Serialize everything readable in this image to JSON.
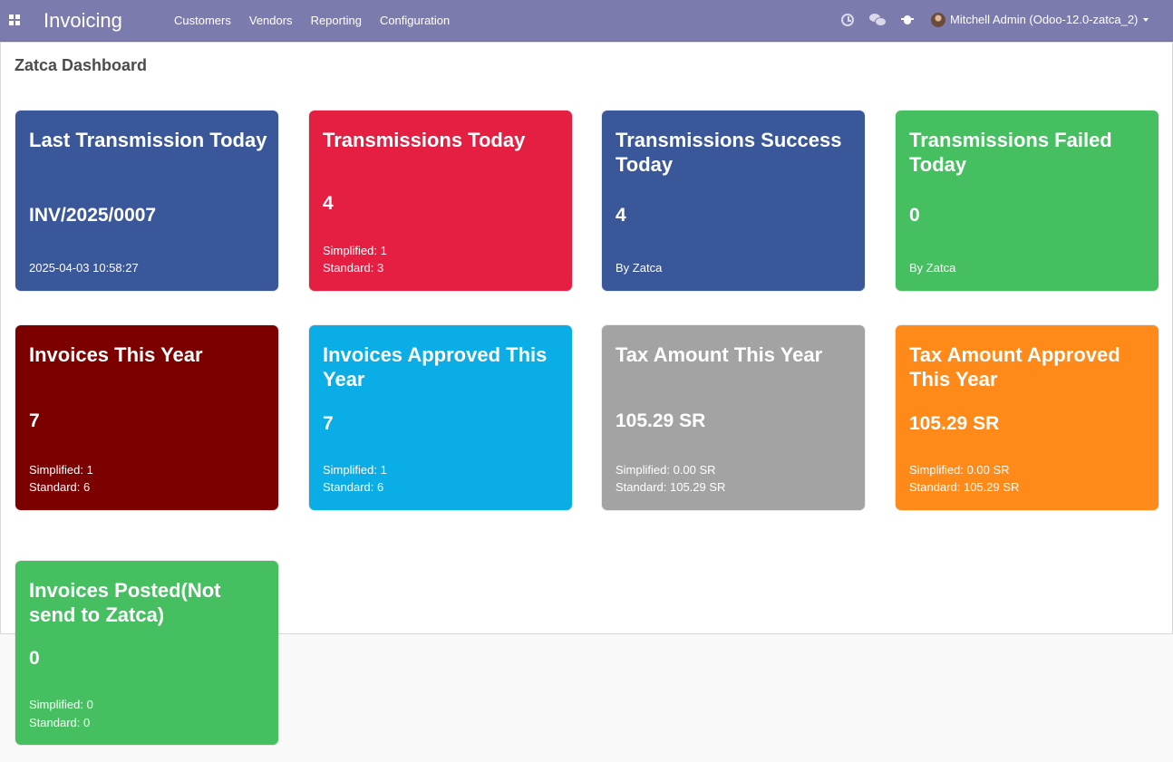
{
  "navbar": {
    "app_name": "Invoicing",
    "menu": [
      "Customers",
      "Vendors",
      "Reporting",
      "Configuration"
    ],
    "user_name": "Mitchell Admin (Odoo-12.0-zatca_2)",
    "icons": [
      "apps-icon",
      "clock-icon",
      "chat-icon",
      "bug-icon",
      "avatar",
      "chevron-down-icon"
    ],
    "background_color": "#7c7bad"
  },
  "page": {
    "title": "Zatca Dashboard"
  },
  "cards": [
    {
      "title": "Last Transmission Today",
      "value": "INV/2025/0007",
      "sub1": "2025-04-03 10:58:27",
      "sub2": "",
      "color": "#3a5799"
    },
    {
      "title": "Transmissions Today",
      "value": "4",
      "sub1": "Simplified: 1",
      "sub2": "Standard: 3",
      "color": "#e41f42"
    },
    {
      "title": "Transmissions Success Today",
      "value": "4",
      "sub1": "By Zatca",
      "sub2": "",
      "color": "#3a5799"
    },
    {
      "title": "Transmissions Failed Today",
      "value": "0",
      "sub1": "By Zatca",
      "sub2": "",
      "color": "#46bf61"
    },
    {
      "title": "Invoices This Year",
      "value": "7",
      "sub1": "Simplified: 1",
      "sub2": "Standard: 6",
      "color": "#7d0001"
    },
    {
      "title": "Invoices Approved This Year",
      "value": "7",
      "sub1": "Simplified: 1",
      "sub2": "Standard: 6",
      "color": "#0bade6"
    },
    {
      "title": "Tax Amount This Year",
      "value": "105.29 SR",
      "sub1": "Simplified: 0.00 SR",
      "sub2": "Standard: 105.29 SR",
      "color": "#a3a3a3"
    },
    {
      "title": "Tax Amount Approved This Year",
      "value": "105.29 SR",
      "sub1": "Simplified: 0.00 SR",
      "sub2": "Standard: 105.29 SR",
      "color": "#ff8a19"
    },
    {
      "title": "Invoices Posted(Not send to Zatca)",
      "value": "0",
      "sub1": "Simplified: 0",
      "sub2": "Standard: 0",
      "color": "#46bf61"
    }
  ]
}
